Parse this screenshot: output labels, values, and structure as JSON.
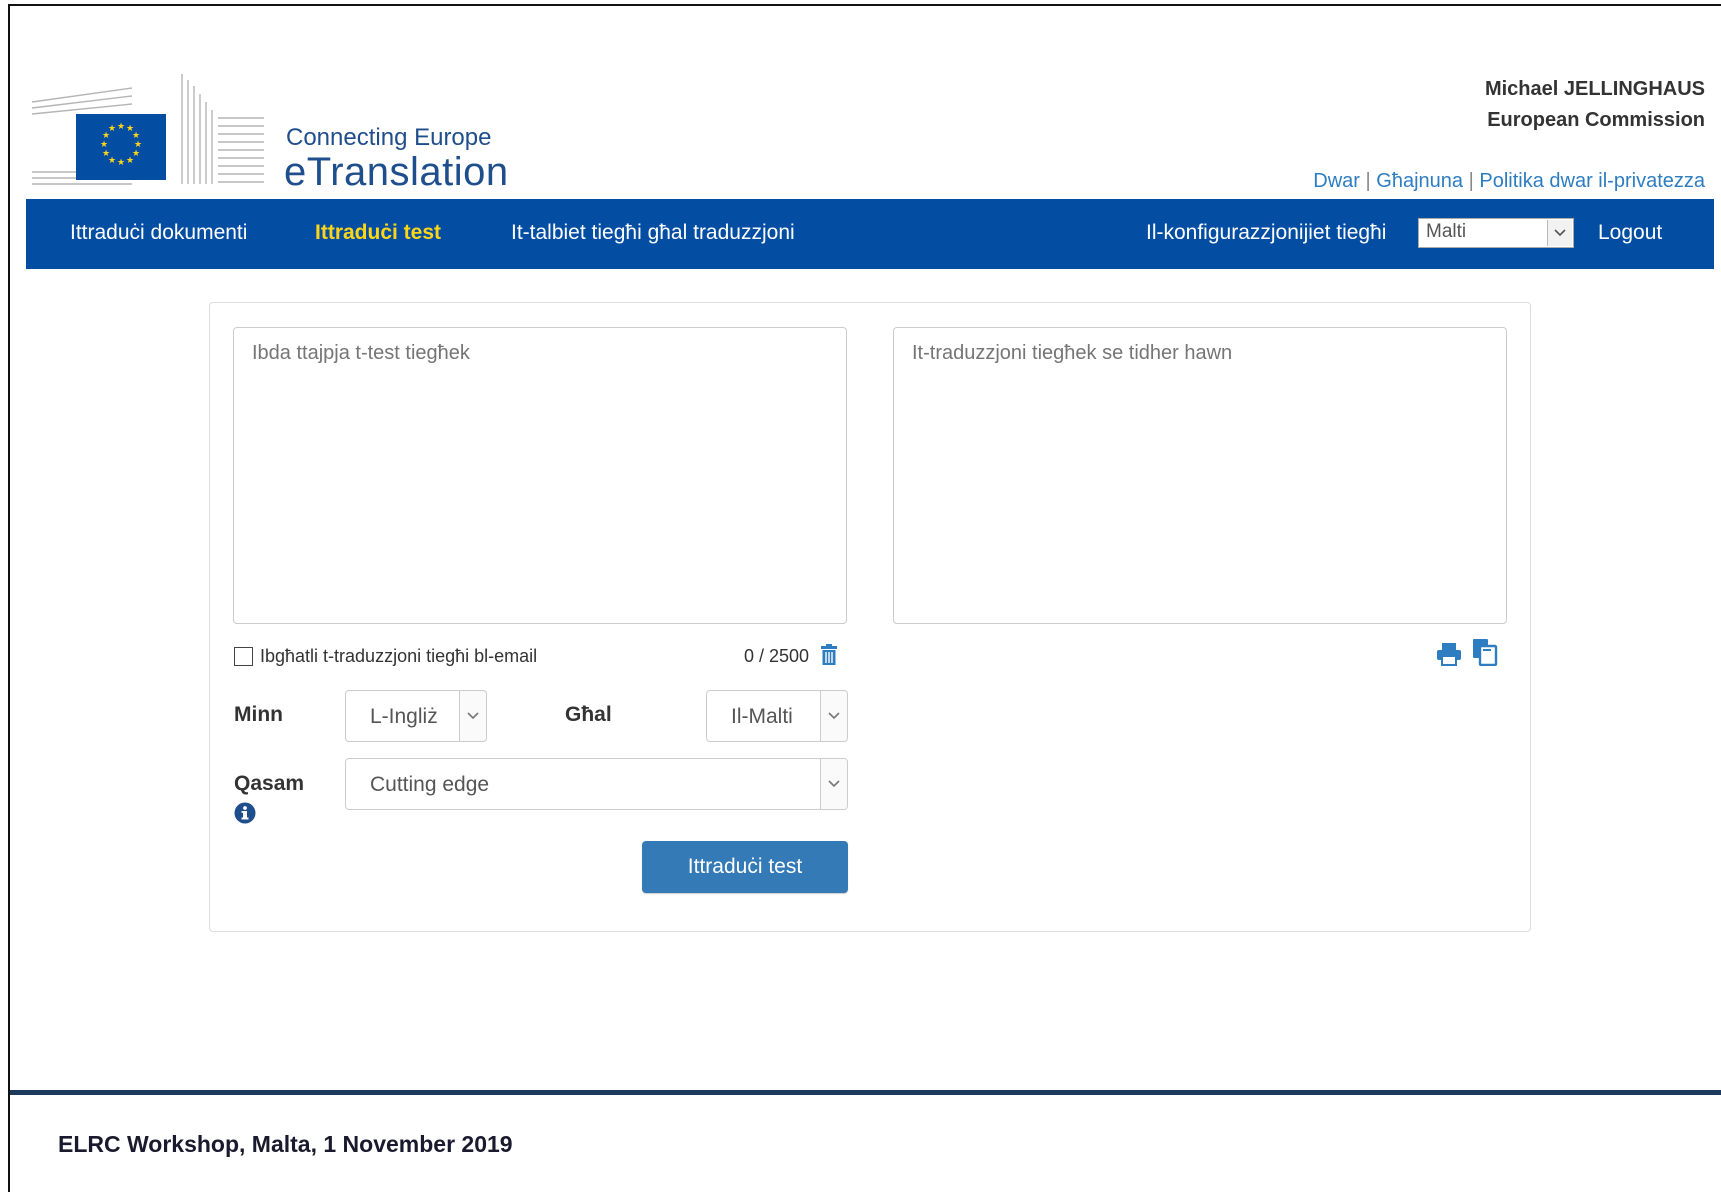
{
  "header": {
    "brand_top": "Connecting Europe",
    "brand_main": "eTranslation",
    "user_name": "Michael JELLINGHAUS",
    "user_org": "European Commission",
    "links": [
      {
        "label": "Dwar"
      },
      {
        "label": "Għajnuna"
      },
      {
        "label": "Politika dwar il-privatezza"
      }
    ],
    "link_separator": "|"
  },
  "nav": {
    "items": [
      {
        "label": "Ittraduċi dokumenti",
        "active": false
      },
      {
        "label": "Ittraduċi test",
        "active": true
      },
      {
        "label": "It-talbiet tiegħi għal traduzzjoni",
        "active": false
      }
    ],
    "config_label": "Il-konfigurazzjonijiet tiegħi",
    "ui_language": "Malti",
    "logout_label": "Logout"
  },
  "form": {
    "source_placeholder": "Ibda ttajpja t-test tiegħek",
    "target_placeholder": "It-traduzzjoni tiegħek se tidher hawn",
    "email_label": "Ibgħatli t-traduzzjoni tiegħi bl-email",
    "email_checked": false,
    "char_count": "0 / 2500",
    "from_label": "Minn",
    "from_value": "L-Ingliż",
    "to_label": "Għal",
    "to_value": "Il-Malti",
    "domain_label": "Qasam",
    "domain_value": "Cutting edge",
    "submit_label": "Ittraduċi test"
  },
  "footer": {
    "text": "ELRC Workshop, Malta, 1 November 2019"
  },
  "colors": {
    "nav_bg": "#034ea2",
    "nav_active": "#ffd617",
    "brand": "#1f4e8c",
    "link": "#2e7dc1",
    "button": "#337ab7",
    "footer_bar": "#1c3a5e"
  }
}
